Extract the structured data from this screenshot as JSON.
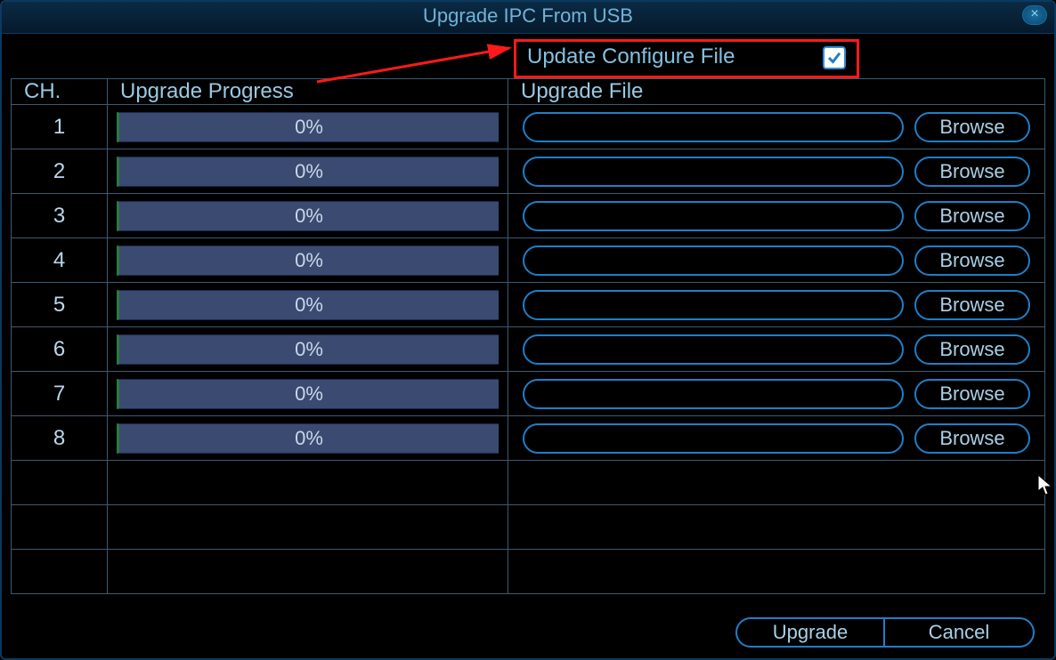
{
  "title": "Upgrade IPC From USB",
  "configure": {
    "label": "Update Configure File",
    "checked": true
  },
  "headers": {
    "ch": "CH.",
    "progress": "Upgrade Progress",
    "file": "Upgrade File"
  },
  "browse_label": "Browse",
  "buttons": {
    "upgrade": "Upgrade",
    "cancel": "Cancel"
  },
  "rows": [
    {
      "ch": "1",
      "progress": "0%",
      "file": ""
    },
    {
      "ch": "2",
      "progress": "0%",
      "file": ""
    },
    {
      "ch": "3",
      "progress": "0%",
      "file": ""
    },
    {
      "ch": "4",
      "progress": "0%",
      "file": ""
    },
    {
      "ch": "5",
      "progress": "0%",
      "file": ""
    },
    {
      "ch": "6",
      "progress": "0%",
      "file": ""
    },
    {
      "ch": "7",
      "progress": "0%",
      "file": ""
    },
    {
      "ch": "8",
      "progress": "0%",
      "file": ""
    }
  ],
  "empty_rows": 3
}
